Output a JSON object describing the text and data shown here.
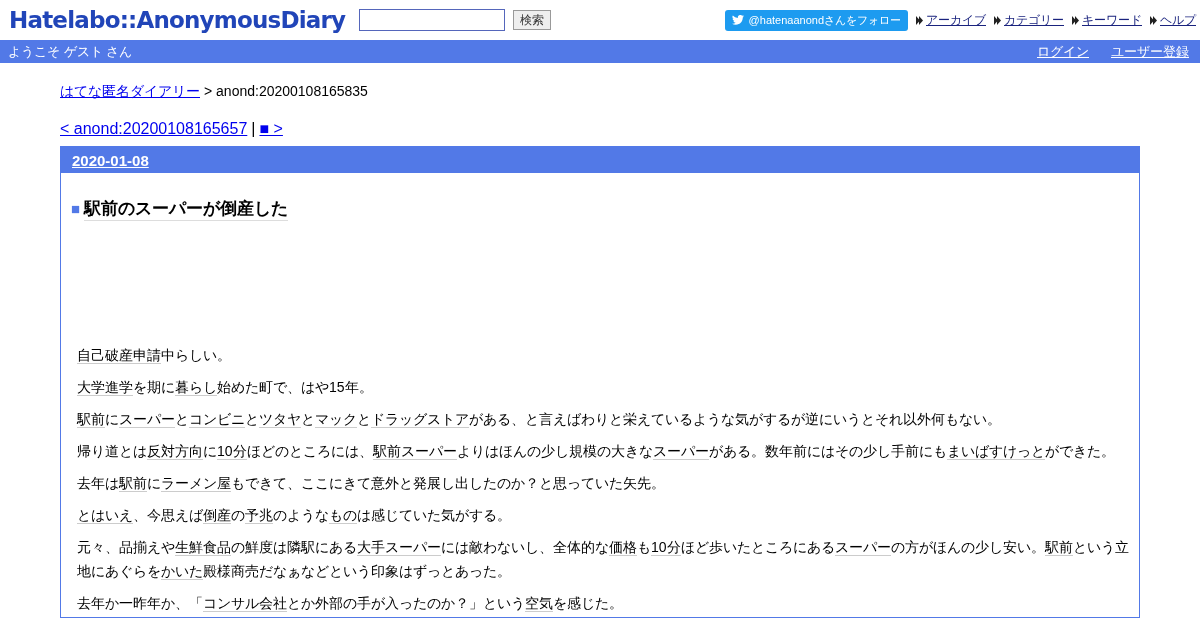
{
  "header": {
    "logo": "Hatelabo::AnonymousDiary",
    "search_button": "検索",
    "follow_button": "@hatenaanondさんをフォロー",
    "nav": [
      "アーカイブ",
      "カテゴリー",
      "キーワード",
      "ヘルプ"
    ]
  },
  "user_bar": {
    "welcome": "ようこそ ゲスト さん",
    "links": [
      "ログイン",
      "ユーザー登録"
    ]
  },
  "breadcrumb": {
    "link": "はてな匿名ダイアリー",
    "current": "> anond:20200108165835"
  },
  "pager": {
    "prev": "< anond:20200108165657",
    "separator": "|",
    "next": "■ >"
  },
  "day": {
    "date": "2020-01-08",
    "title_mark": "■",
    "title": "駅前のスーパーが倒産した",
    "paragraphs": [
      [
        {
          "text": "自己破産申請",
          "keyword": true
        },
        {
          "text": "中らしい。",
          "keyword": false
        }
      ],
      [
        {
          "text": "大学進学",
          "keyword": true
        },
        {
          "text": "を期に",
          "keyword": false
        },
        {
          "text": "暮らし",
          "keyword": true
        },
        {
          "text": "始めた町で、はや15年。",
          "keyword": false
        }
      ],
      [
        {
          "text": "駅前",
          "keyword": true
        },
        {
          "text": "に",
          "keyword": false
        },
        {
          "text": "スーパー",
          "keyword": true
        },
        {
          "text": "と",
          "keyword": false
        },
        {
          "text": "コンビニ",
          "keyword": true
        },
        {
          "text": "と",
          "keyword": false
        },
        {
          "text": "ツタヤ",
          "keyword": true
        },
        {
          "text": "と",
          "keyword": false
        },
        {
          "text": "マック",
          "keyword": true
        },
        {
          "text": "と",
          "keyword": false
        },
        {
          "text": "ドラッグストア",
          "keyword": true
        },
        {
          "text": "がある、と言えばわりと栄えているような気がするが逆にいうとそれ以外何もない。",
          "keyword": false
        }
      ],
      [
        {
          "text": "帰り道とは",
          "keyword": false
        },
        {
          "text": "反対方向",
          "keyword": true
        },
        {
          "text": "に",
          "keyword": false
        },
        {
          "text": "10分",
          "keyword": true
        },
        {
          "text": "ほどのところには、",
          "keyword": false
        },
        {
          "text": "駅前スーパー",
          "keyword": true
        },
        {
          "text": "よりはほんの少し規模の大きな",
          "keyword": false
        },
        {
          "text": "スーパー",
          "keyword": true
        },
        {
          "text": "がある。数年前にはその少し手前にも",
          "keyword": false
        },
        {
          "text": "まいばすけっと",
          "keyword": true
        },
        {
          "text": "ができた。",
          "keyword": false
        }
      ],
      [
        {
          "text": "去年は",
          "keyword": false
        },
        {
          "text": "駅前",
          "keyword": true
        },
        {
          "text": "に",
          "keyword": false
        },
        {
          "text": "ラーメン屋",
          "keyword": true
        },
        {
          "text": "もできて、ここにきて意外と発展し出したのか？と思っていた矢先。",
          "keyword": false
        }
      ],
      [
        {
          "text": "とはいえ",
          "keyword": true
        },
        {
          "text": "、今思えば",
          "keyword": false
        },
        {
          "text": "倒産",
          "keyword": true
        },
        {
          "text": "の",
          "keyword": false
        },
        {
          "text": "予兆",
          "keyword": true
        },
        {
          "text": "のような",
          "keyword": false
        },
        {
          "text": "もの",
          "keyword": true
        },
        {
          "text": "は感じていた気がする。",
          "keyword": false
        }
      ],
      [
        {
          "text": "元々、品揃えや",
          "keyword": false
        },
        {
          "text": "生鮮食品",
          "keyword": true
        },
        {
          "text": "の鮮度は隣駅にある",
          "keyword": false
        },
        {
          "text": "大手スーパー",
          "keyword": true
        },
        {
          "text": "には敵わないし、全体的な",
          "keyword": false
        },
        {
          "text": "価格",
          "keyword": true
        },
        {
          "text": "も",
          "keyword": false
        },
        {
          "text": "10分",
          "keyword": true
        },
        {
          "text": "ほど歩いたところにある",
          "keyword": false
        },
        {
          "text": "スーパー",
          "keyword": true
        },
        {
          "text": "の方がほんの少し安い。",
          "keyword": false
        },
        {
          "text": "駅前",
          "keyword": true
        },
        {
          "text": "という立地にあぐらを",
          "keyword": false
        },
        {
          "text": "かいた",
          "keyword": true
        },
        {
          "text": "殿様商売だなぁなどという印象はずっとあった。",
          "keyword": false
        }
      ],
      [
        {
          "text": "去年か一昨年か、「",
          "keyword": false
        },
        {
          "text": "コンサル会社",
          "keyword": true
        },
        {
          "text": "とか外部の手が入ったのか？」という",
          "keyword": false
        },
        {
          "text": "空気",
          "keyword": true
        },
        {
          "text": "を感じた。",
          "keyword": false
        }
      ]
    ]
  }
}
